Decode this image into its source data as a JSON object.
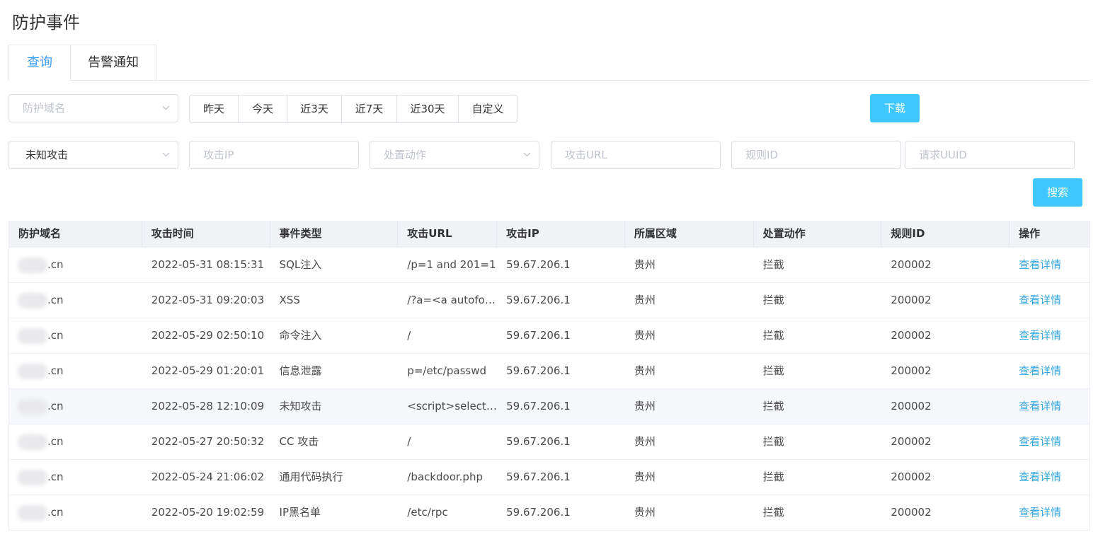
{
  "page": {
    "title": "防护事件"
  },
  "tabs": [
    {
      "label": "查询",
      "active": true
    },
    {
      "label": "告警通知",
      "active": false
    }
  ],
  "filters": {
    "domain_placeholder": "防护域名",
    "date_ranges": [
      "昨天",
      "今天",
      "近3天",
      "近7天",
      "近30天",
      "自定义"
    ],
    "download_label": "下载",
    "attack_type_value": "未知攻击",
    "attack_ip_placeholder": "攻击IP",
    "action_placeholder": "处置动作",
    "attack_url_placeholder": "攻击URL",
    "rule_id_placeholder": "规则ID",
    "uuid_placeholder": "请求UUID",
    "search_label": "搜索"
  },
  "table": {
    "columns": [
      "防护域名",
      "攻击时间",
      "事件类型",
      "攻击URL",
      "攻击IP",
      "所属区域",
      "处置动作",
      "规则ID",
      "操作"
    ],
    "rows": [
      {
        "domain": ".cn",
        "time": "2022-05-31 08:15:31",
        "type": "SQL注入",
        "url": "/p=1 and 201=1",
        "ip": "59.67.206.1",
        "region": "贵州",
        "action": "拦截",
        "rule": "200002",
        "op": "查看详情"
      },
      {
        "domain": ".cn",
        "time": "2022-05-31 09:20:03",
        "type": "XSS",
        "url": "/?a=<a autofoc...",
        "ip": "59.67.206.1",
        "region": "贵州",
        "action": "拦截",
        "rule": "200002",
        "op": "查看详情"
      },
      {
        "domain": ".cn",
        "time": "2022-05-29 02:50:10",
        "type": "命令注入",
        "url": "/",
        "ip": "59.67.206.1",
        "region": "贵州",
        "action": "拦截",
        "rule": "200002",
        "op": "查看详情"
      },
      {
        "domain": ".cn",
        "time": "2022-05-29 01:20:01",
        "type": "信息泄露",
        "url": "p=/etc/passwd",
        "ip": "59.67.206.1",
        "region": "贵州",
        "action": "拦截",
        "rule": "200002",
        "op": "查看详情"
      },
      {
        "domain": ".cn",
        "time": "2022-05-28 12:10:09",
        "type": "未知攻击",
        "url": "<script>select ...",
        "ip": "59.67.206.1",
        "region": "贵州",
        "action": "拦截",
        "rule": "200002",
        "op": "查看详情"
      },
      {
        "domain": ".cn",
        "time": "2022-05-27 20:50:32",
        "type": "CC 攻击",
        "url": "/",
        "ip": "59.67.206.1",
        "region": "贵州",
        "action": "拦截",
        "rule": "200002",
        "op": "查看详情"
      },
      {
        "domain": ".cn",
        "time": "2022-05-24 21:06:02",
        "type": "通用代码执行",
        "url": "/backdoor.php",
        "ip": "59.67.206.1",
        "region": "贵州",
        "action": "拦截",
        "rule": "200002",
        "op": "查看详情"
      },
      {
        "domain": ".cn",
        "time": "2022-05-20 19:02:59",
        "type": "IP黑名单",
        "url": "/etc/rpc",
        "ip": "59.67.206.1",
        "region": "贵州",
        "action": "拦截",
        "rule": "200002",
        "op": "查看详情"
      }
    ]
  },
  "colors": {
    "accent": "#409eff",
    "button": "#3ec8ff",
    "link": "#37a8e0"
  },
  "icons": {
    "select_arrow": "chevron-down-icon"
  }
}
